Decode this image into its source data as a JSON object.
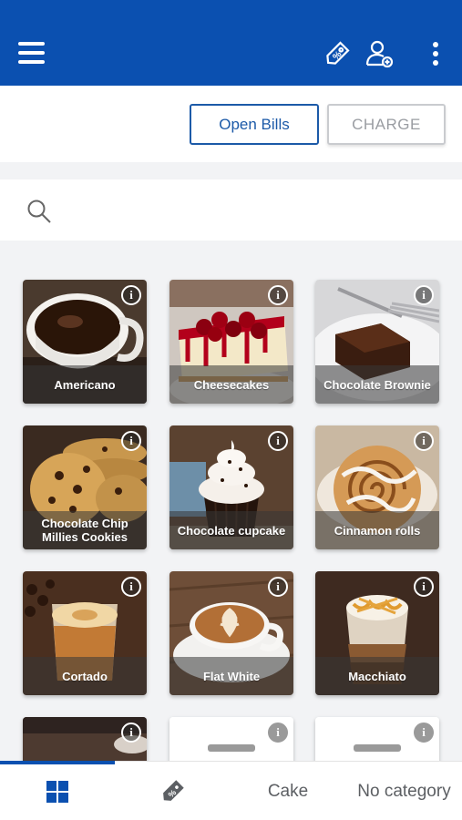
{
  "colors": {
    "primary": "#0b50b0",
    "accent_text": "#1c5aa8",
    "disabled": "#9a9da2"
  },
  "header": {
    "menu_icon": "hamburger-icon",
    "actions": [
      {
        "name": "discount-tag-icon"
      },
      {
        "name": "add-customer-icon"
      },
      {
        "name": "more-vertical-icon"
      }
    ]
  },
  "actions": {
    "open_bills_label": "Open Bills",
    "charge_label": "CHARGE"
  },
  "search": {
    "icon": "search-icon",
    "placeholder": ""
  },
  "products": [
    {
      "label": "Americano"
    },
    {
      "label": "Cheesecakes"
    },
    {
      "label": "Chocolate Brownie"
    },
    {
      "label": "Chocolate Chip Millies Cookies"
    },
    {
      "label": "Chocolate cupcake"
    },
    {
      "label": "Cinnamon rolls"
    },
    {
      "label": "Cortado"
    },
    {
      "label": "Flat White"
    },
    {
      "label": "Macchiato"
    },
    {
      "label": ""
    },
    {
      "label": ""
    },
    {
      "label": ""
    }
  ],
  "info_glyph": "i",
  "bottom_tabs": [
    {
      "icon": "grid-icon",
      "active": true
    },
    {
      "icon": "discount-tag-icon"
    },
    {
      "label": "Cake"
    },
    {
      "label": "No category"
    }
  ]
}
